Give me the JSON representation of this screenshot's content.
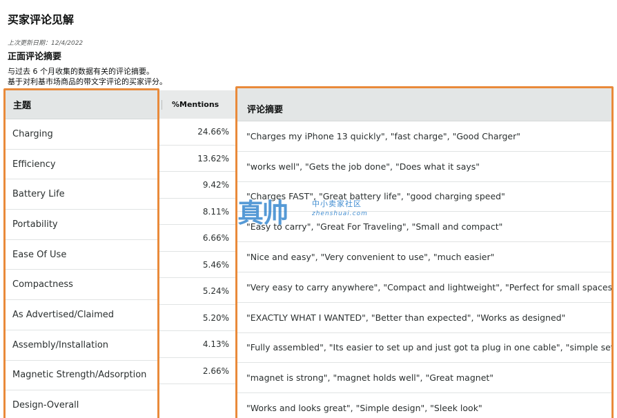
{
  "page": {
    "title": "买家评论见解",
    "last_updated": "上次更新日期：12/4/2022",
    "section_title": "正面评论摘要",
    "description_line1": "与过去 6 个月收集的数据有关的评论摘要。",
    "description_line2": "基于对利基市场商品的带文字评论的买家评分。"
  },
  "table": {
    "theme_header": "主题",
    "mentions_header": "%Mentions",
    "summary_header": "评论摘要",
    "rows": [
      {
        "theme": "Charging",
        "mentions": "24.66%",
        "summary": "\"Charges my iPhone 13 quickly\", \"fast charge\", \"Good Charger\""
      },
      {
        "theme": "Efficiency",
        "mentions": "13.62%",
        "summary": "\"works well\", \"Gets the job done\", \"Does what it says\""
      },
      {
        "theme": "Battery Life",
        "mentions": "9.42%",
        "summary": "\"Charges FAST\", \"Great battery life\", \"good charging speed\""
      },
      {
        "theme": "Portability",
        "mentions": "8.11%",
        "summary": "\"Easy to carry\", \"Great For Traveling\", \"Small and compact\""
      },
      {
        "theme": "Ease Of Use",
        "mentions": "6.66%",
        "summary": "\"Nice and easy\", \"Very convenient to use\", \"much easier\""
      },
      {
        "theme": "Compactness",
        "mentions": "5.46%",
        "summary": "\"Very easy to carry anywhere\", \"Compact and lightweight\", \"Perfect for small spaces\""
      },
      {
        "theme": "As Advertised/Claimed",
        "mentions": "5.24%",
        "summary": "\"EXACTLY WHAT I WANTED\", \"Better than expected\", \"Works as designed\""
      },
      {
        "theme": "Assembly/Installation",
        "mentions": "5.20%",
        "summary": "\"Fully assembled\", \"Its easier to set up and just got ta plug in one cable\", \"simple setup\""
      },
      {
        "theme": "Magnetic Strength/Adsorption",
        "mentions": "4.13%",
        "summary": "\"magnet is strong\", \"magnet holds well\", \"Great magnet\""
      },
      {
        "theme": "Design-Overall",
        "mentions": "2.66%",
        "summary": "\"Works and looks great\", \"Simple design\", \"Sleek look\""
      }
    ]
  },
  "watermark": {
    "big": "真帅",
    "cn": "中小卖家社区",
    "en": "zhenshuai.com"
  },
  "colors": {
    "highlight_border": "#e98a3a",
    "header_bg": "#e3e6e6"
  }
}
